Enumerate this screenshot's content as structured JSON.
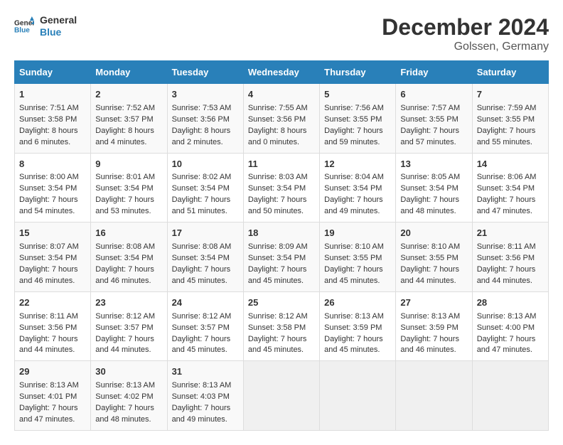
{
  "header": {
    "logo_line1": "General",
    "logo_line2": "Blue",
    "month": "December 2024",
    "location": "Golssen, Germany"
  },
  "days_of_week": [
    "Sunday",
    "Monday",
    "Tuesday",
    "Wednesday",
    "Thursday",
    "Friday",
    "Saturday"
  ],
  "weeks": [
    [
      {
        "day": "1",
        "sunrise": "Sunrise: 7:51 AM",
        "sunset": "Sunset: 3:58 PM",
        "daylight": "Daylight: 8 hours and 6 minutes."
      },
      {
        "day": "2",
        "sunrise": "Sunrise: 7:52 AM",
        "sunset": "Sunset: 3:57 PM",
        "daylight": "Daylight: 8 hours and 4 minutes."
      },
      {
        "day": "3",
        "sunrise": "Sunrise: 7:53 AM",
        "sunset": "Sunset: 3:56 PM",
        "daylight": "Daylight: 8 hours and 2 minutes."
      },
      {
        "day": "4",
        "sunrise": "Sunrise: 7:55 AM",
        "sunset": "Sunset: 3:56 PM",
        "daylight": "Daylight: 8 hours and 0 minutes."
      },
      {
        "day": "5",
        "sunrise": "Sunrise: 7:56 AM",
        "sunset": "Sunset: 3:55 PM",
        "daylight": "Daylight: 7 hours and 59 minutes."
      },
      {
        "day": "6",
        "sunrise": "Sunrise: 7:57 AM",
        "sunset": "Sunset: 3:55 PM",
        "daylight": "Daylight: 7 hours and 57 minutes."
      },
      {
        "day": "7",
        "sunrise": "Sunrise: 7:59 AM",
        "sunset": "Sunset: 3:55 PM",
        "daylight": "Daylight: 7 hours and 55 minutes."
      }
    ],
    [
      {
        "day": "8",
        "sunrise": "Sunrise: 8:00 AM",
        "sunset": "Sunset: 3:54 PM",
        "daylight": "Daylight: 7 hours and 54 minutes."
      },
      {
        "day": "9",
        "sunrise": "Sunrise: 8:01 AM",
        "sunset": "Sunset: 3:54 PM",
        "daylight": "Daylight: 7 hours and 53 minutes."
      },
      {
        "day": "10",
        "sunrise": "Sunrise: 8:02 AM",
        "sunset": "Sunset: 3:54 PM",
        "daylight": "Daylight: 7 hours and 51 minutes."
      },
      {
        "day": "11",
        "sunrise": "Sunrise: 8:03 AM",
        "sunset": "Sunset: 3:54 PM",
        "daylight": "Daylight: 7 hours and 50 minutes."
      },
      {
        "day": "12",
        "sunrise": "Sunrise: 8:04 AM",
        "sunset": "Sunset: 3:54 PM",
        "daylight": "Daylight: 7 hours and 49 minutes."
      },
      {
        "day": "13",
        "sunrise": "Sunrise: 8:05 AM",
        "sunset": "Sunset: 3:54 PM",
        "daylight": "Daylight: 7 hours and 48 minutes."
      },
      {
        "day": "14",
        "sunrise": "Sunrise: 8:06 AM",
        "sunset": "Sunset: 3:54 PM",
        "daylight": "Daylight: 7 hours and 47 minutes."
      }
    ],
    [
      {
        "day": "15",
        "sunrise": "Sunrise: 8:07 AM",
        "sunset": "Sunset: 3:54 PM",
        "daylight": "Daylight: 7 hours and 46 minutes."
      },
      {
        "day": "16",
        "sunrise": "Sunrise: 8:08 AM",
        "sunset": "Sunset: 3:54 PM",
        "daylight": "Daylight: 7 hours and 46 minutes."
      },
      {
        "day": "17",
        "sunrise": "Sunrise: 8:08 AM",
        "sunset": "Sunset: 3:54 PM",
        "daylight": "Daylight: 7 hours and 45 minutes."
      },
      {
        "day": "18",
        "sunrise": "Sunrise: 8:09 AM",
        "sunset": "Sunset: 3:54 PM",
        "daylight": "Daylight: 7 hours and 45 minutes."
      },
      {
        "day": "19",
        "sunrise": "Sunrise: 8:10 AM",
        "sunset": "Sunset: 3:55 PM",
        "daylight": "Daylight: 7 hours and 45 minutes."
      },
      {
        "day": "20",
        "sunrise": "Sunrise: 8:10 AM",
        "sunset": "Sunset: 3:55 PM",
        "daylight": "Daylight: 7 hours and 44 minutes."
      },
      {
        "day": "21",
        "sunrise": "Sunrise: 8:11 AM",
        "sunset": "Sunset: 3:56 PM",
        "daylight": "Daylight: 7 hours and 44 minutes."
      }
    ],
    [
      {
        "day": "22",
        "sunrise": "Sunrise: 8:11 AM",
        "sunset": "Sunset: 3:56 PM",
        "daylight": "Daylight: 7 hours and 44 minutes."
      },
      {
        "day": "23",
        "sunrise": "Sunrise: 8:12 AM",
        "sunset": "Sunset: 3:57 PM",
        "daylight": "Daylight: 7 hours and 44 minutes."
      },
      {
        "day": "24",
        "sunrise": "Sunrise: 8:12 AM",
        "sunset": "Sunset: 3:57 PM",
        "daylight": "Daylight: 7 hours and 45 minutes."
      },
      {
        "day": "25",
        "sunrise": "Sunrise: 8:12 AM",
        "sunset": "Sunset: 3:58 PM",
        "daylight": "Daylight: 7 hours and 45 minutes."
      },
      {
        "day": "26",
        "sunrise": "Sunrise: 8:13 AM",
        "sunset": "Sunset: 3:59 PM",
        "daylight": "Daylight: 7 hours and 45 minutes."
      },
      {
        "day": "27",
        "sunrise": "Sunrise: 8:13 AM",
        "sunset": "Sunset: 3:59 PM",
        "daylight": "Daylight: 7 hours and 46 minutes."
      },
      {
        "day": "28",
        "sunrise": "Sunrise: 8:13 AM",
        "sunset": "Sunset: 4:00 PM",
        "daylight": "Daylight: 7 hours and 47 minutes."
      }
    ],
    [
      {
        "day": "29",
        "sunrise": "Sunrise: 8:13 AM",
        "sunset": "Sunset: 4:01 PM",
        "daylight": "Daylight: 7 hours and 47 minutes."
      },
      {
        "day": "30",
        "sunrise": "Sunrise: 8:13 AM",
        "sunset": "Sunset: 4:02 PM",
        "daylight": "Daylight: 7 hours and 48 minutes."
      },
      {
        "day": "31",
        "sunrise": "Sunrise: 8:13 AM",
        "sunset": "Sunset: 4:03 PM",
        "daylight": "Daylight: 7 hours and 49 minutes."
      },
      null,
      null,
      null,
      null
    ]
  ]
}
